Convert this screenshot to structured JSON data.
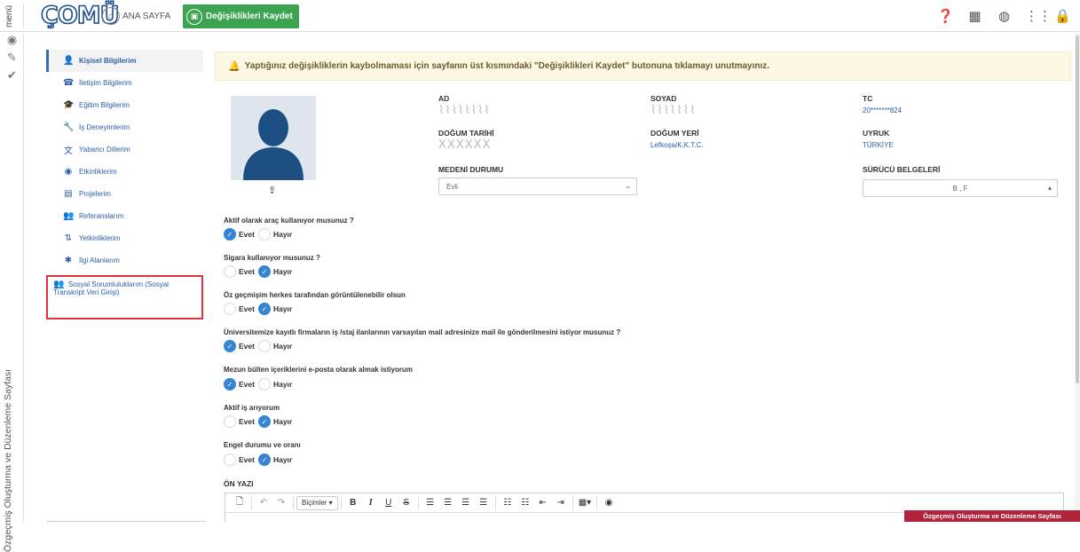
{
  "topbar": {
    "menu_label": "menü",
    "logo_text": "ÇOMÜ",
    "home_label": "ANA SAYFA",
    "save_label": "Değişiklikleri Kaydet",
    "icons": [
      "help-icon",
      "calendar-icon",
      "globe-icon",
      "apps-grid-icon",
      "lock-icon"
    ]
  },
  "left_rail": {
    "icons": [
      "eye-icon",
      "edit-icon",
      "check-icon"
    ],
    "vertical_text": "Özgeçmiş Oluşturma ve Düzenleme Sayfası"
  },
  "sidebar": {
    "items": [
      {
        "label": "Kişisel Bilgilerim",
        "icon": "user-icon",
        "glyph": "👤"
      },
      {
        "label": "İletişim Bilgilerim",
        "icon": "phone-icon",
        "glyph": "☎"
      },
      {
        "label": "Eğitim Bilgilerim",
        "icon": "graduation-cap-icon",
        "glyph": "🎓"
      },
      {
        "label": "İş Deneyimlerim",
        "icon": "wrench-icon",
        "glyph": "🔧"
      },
      {
        "label": "Yabancı Dillerim",
        "icon": "language-icon",
        "glyph": "文"
      },
      {
        "label": "Etkinliklerim",
        "icon": "dot-circle-icon",
        "glyph": "◉"
      },
      {
        "label": "Projelerim",
        "icon": "file-icon",
        "glyph": "▤"
      },
      {
        "label": "Referanslarım",
        "icon": "user-plus-icon",
        "glyph": "👥"
      },
      {
        "label": "Yetkinliklerim",
        "icon": "sort-icon",
        "glyph": "⇅"
      },
      {
        "label": "İlgi Alanlarım",
        "icon": "asterisk-icon",
        "glyph": "✱"
      }
    ],
    "highlight_line1": "Sosyal Sorumluluklarım (Sosyal",
    "highlight_line2": "Transkript Veri Girişi)"
  },
  "notice": {
    "text": "Yaptığınız değişikliklerin kaybolmaması için sayfanın üst kısmındaki \"Değişiklikleri Kaydet\" butonuna tıklamayı unutmayınız."
  },
  "profile": {
    "ad_label": "AD",
    "soyad_label": "SOYAD",
    "tc_label": "TC",
    "tc_value": "20*******824",
    "dogum_tarihi_label": "DOĞUM TARİHİ",
    "dogum_yeri_label": "DOĞUM YERİ",
    "dogum_yeri_value": "Lefkoşa/K.K.T.C.",
    "uyruk_label": "UYRUK",
    "uyruk_value": "TÜRKİYE",
    "medeni_label": "MEDENİ DURUMU",
    "medeni_value": "Evli",
    "surucu_label": "SÜRÜCÜ BELGELERİ",
    "surucu_value": "B , F"
  },
  "questions": [
    {
      "text": "Aktif olarak araç kullanıyor musunuz ?",
      "selected": "Evet"
    },
    {
      "text": "Sigara kullanıyor musunuz ?",
      "selected": "Hayır"
    },
    {
      "text": "Öz geçmişim herkes tarafından görüntülenebilir olsun",
      "selected": "Hayır"
    },
    {
      "text": "Üniversitemize kayıtlı firmaların iş /staj ilanlarının varsayılan mail adresinize mail ile gönderilmesini istiyor musunuz ?",
      "selected": "Evet"
    },
    {
      "text": "Mezun bülten içeriklerini e-posta olarak almak istiyorum",
      "selected": "Evet"
    },
    {
      "text": "Aktif iş arıyorum",
      "selected": "Hayır"
    },
    {
      "text": "Engel durumu ve oranı",
      "selected": "Hayır"
    }
  ],
  "option_labels": {
    "yes": "Evet",
    "no": "Hayır"
  },
  "editor": {
    "label": "ÖN YAZI",
    "styles_label": "Biçimler"
  },
  "footer_badge": "Özgeçmiş Oluşturma ve Düzenleme Sayfası"
}
